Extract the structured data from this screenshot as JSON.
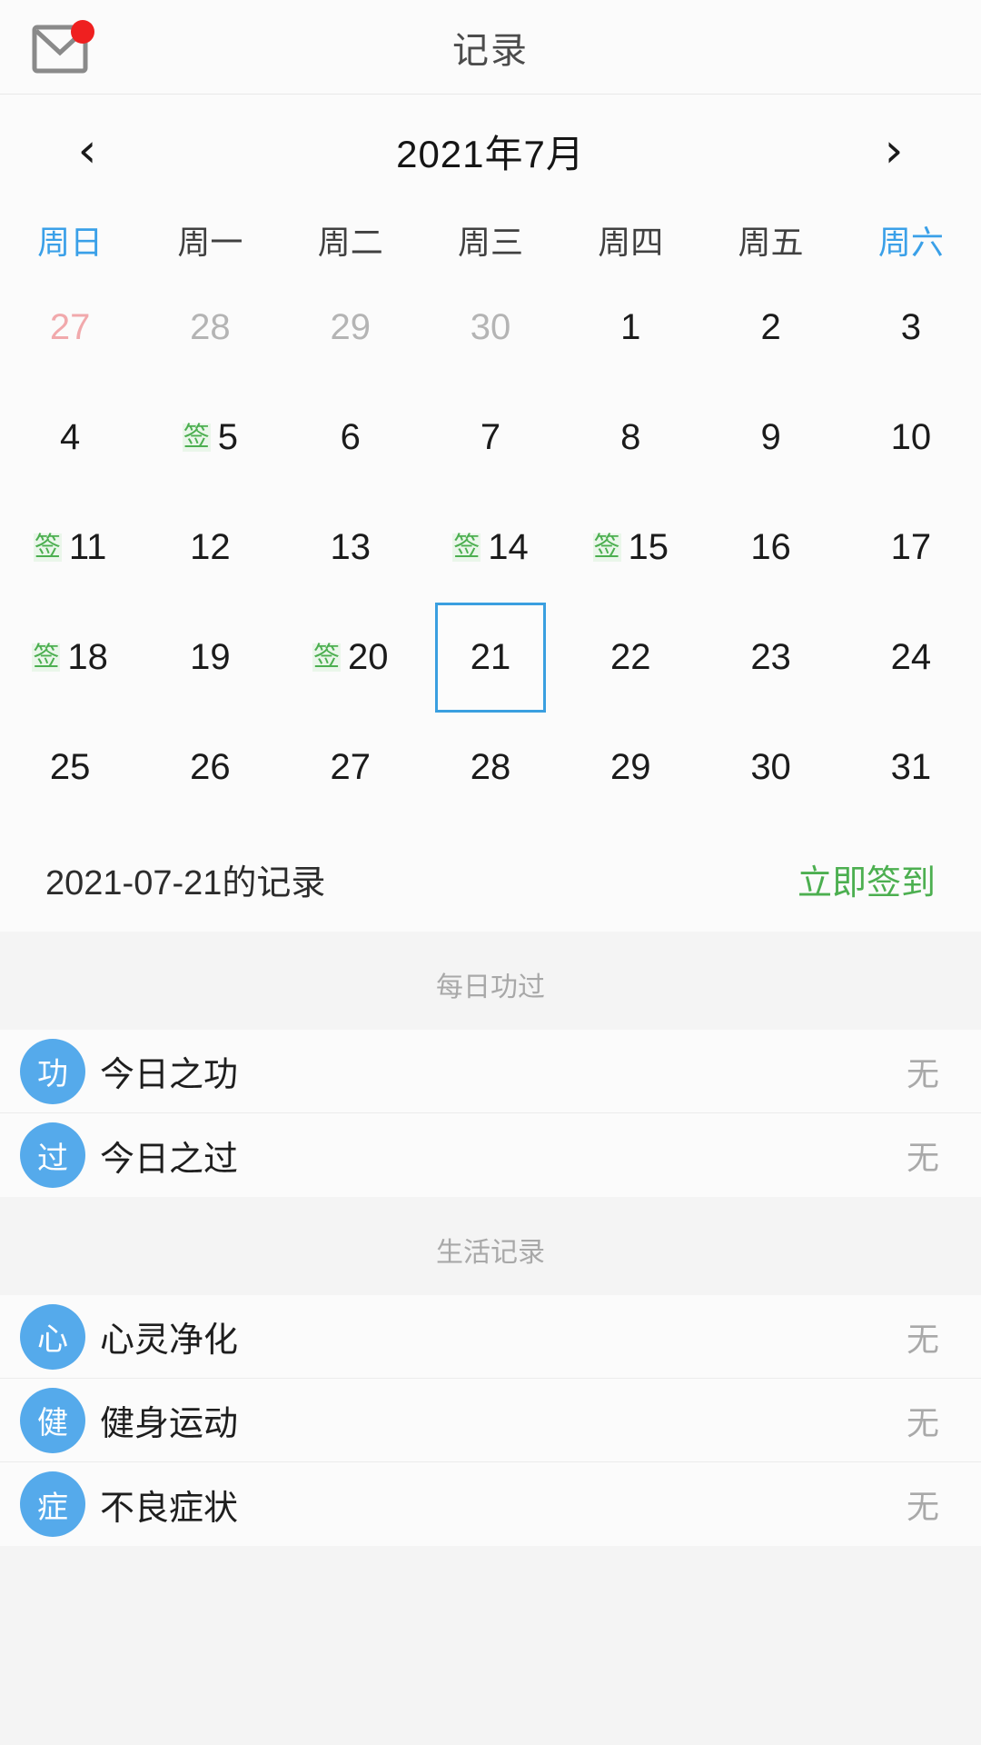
{
  "header": {
    "mail_icon": "mail-icon",
    "has_unread_badge": true,
    "title": "记录"
  },
  "calendar": {
    "prev_label": "‹",
    "next_label": "›",
    "month_title": "2021年7月",
    "weekdays": [
      {
        "label": "周日",
        "accent": true
      },
      {
        "label": "周一",
        "accent": false
      },
      {
        "label": "周二",
        "accent": false
      },
      {
        "label": "周三",
        "accent": false
      },
      {
        "label": "周四",
        "accent": false
      },
      {
        "label": "周五",
        "accent": false
      },
      {
        "label": "周六",
        "accent": true
      }
    ],
    "sign_mark": "签",
    "selected_day": 21,
    "accent_color": "#3a9fe0",
    "sign_color": "#4caf50",
    "days": [
      {
        "num": "27",
        "state": "out-sunday",
        "signed": false
      },
      {
        "num": "28",
        "state": "out",
        "signed": false
      },
      {
        "num": "29",
        "state": "out",
        "signed": false
      },
      {
        "num": "30",
        "state": "out",
        "signed": false
      },
      {
        "num": "1",
        "state": "in",
        "signed": false
      },
      {
        "num": "2",
        "state": "in",
        "signed": false
      },
      {
        "num": "3",
        "state": "in",
        "signed": false
      },
      {
        "num": "4",
        "state": "in",
        "signed": false
      },
      {
        "num": "5",
        "state": "in",
        "signed": true
      },
      {
        "num": "6",
        "state": "in",
        "signed": false
      },
      {
        "num": "7",
        "state": "in",
        "signed": false
      },
      {
        "num": "8",
        "state": "in",
        "signed": false
      },
      {
        "num": "9",
        "state": "in",
        "signed": false
      },
      {
        "num": "10",
        "state": "in",
        "signed": false
      },
      {
        "num": "11",
        "state": "in",
        "signed": true
      },
      {
        "num": "12",
        "state": "in",
        "signed": false
      },
      {
        "num": "13",
        "state": "in",
        "signed": false
      },
      {
        "num": "14",
        "state": "in",
        "signed": true
      },
      {
        "num": "15",
        "state": "in",
        "signed": true
      },
      {
        "num": "16",
        "state": "in",
        "signed": false
      },
      {
        "num": "17",
        "state": "in",
        "signed": false
      },
      {
        "num": "18",
        "state": "in",
        "signed": true
      },
      {
        "num": "19",
        "state": "in",
        "signed": false
      },
      {
        "num": "20",
        "state": "in",
        "signed": true
      },
      {
        "num": "21",
        "state": "in",
        "signed": false,
        "selected": true
      },
      {
        "num": "22",
        "state": "in",
        "signed": false
      },
      {
        "num": "23",
        "state": "in",
        "signed": false
      },
      {
        "num": "24",
        "state": "in",
        "signed": false
      },
      {
        "num": "25",
        "state": "in",
        "signed": false
      },
      {
        "num": "26",
        "state": "in",
        "signed": false
      },
      {
        "num": "27",
        "state": "in",
        "signed": false
      },
      {
        "num": "28",
        "state": "in",
        "signed": false
      },
      {
        "num": "29",
        "state": "in",
        "signed": false
      },
      {
        "num": "30",
        "state": "in",
        "signed": false
      },
      {
        "num": "31",
        "state": "in",
        "signed": false
      }
    ]
  },
  "record": {
    "date_label": "2021-07-21的记录",
    "checkin_label": "立即签到"
  },
  "sections": [
    {
      "title": "每日功过",
      "items": [
        {
          "badge": "功",
          "label": "今日之功",
          "value": "无"
        },
        {
          "badge": "过",
          "label": "今日之过",
          "value": "无"
        }
      ]
    },
    {
      "title": "生活记录",
      "items": [
        {
          "badge": "心",
          "label": "心灵净化",
          "value": "无"
        },
        {
          "badge": "健",
          "label": "健身运动",
          "value": "无"
        },
        {
          "badge": "症",
          "label": "不良症状",
          "value": "无"
        }
      ]
    }
  ]
}
